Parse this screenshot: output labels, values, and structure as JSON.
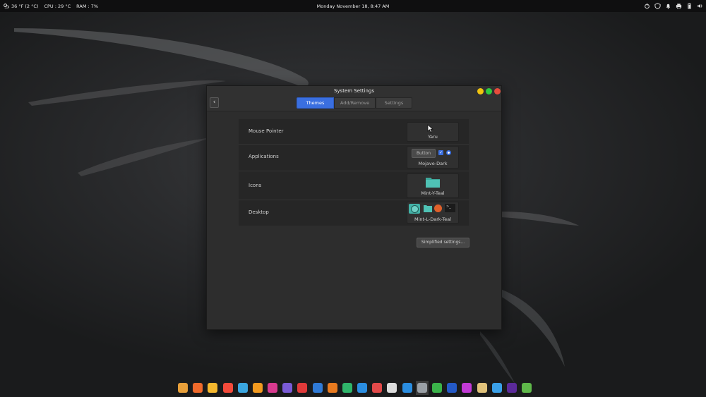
{
  "top_panel": {
    "weather": "36 °F (2 °C)",
    "cpu": "CPU : 29 °C",
    "ram": "RAM : 7%",
    "clock": "Monday November 18, 8:47 AM",
    "tray_icons": [
      "power-icon",
      "shield-icon",
      "bell-icon",
      "printer-icon",
      "battery-icon",
      "volume-icon"
    ]
  },
  "window": {
    "title": "System Settings",
    "tabs": [
      {
        "label": "Themes",
        "active": true
      },
      {
        "label": "Add/Remove",
        "active": false
      },
      {
        "label": "Settings",
        "active": false
      }
    ],
    "rows": [
      {
        "label": "Mouse Pointer",
        "value": "Yaru"
      },
      {
        "label": "Applications",
        "value": "Mojave-Dark",
        "preview_button": "Button"
      },
      {
        "label": "Icons",
        "value": "Mint-Y-Teal"
      },
      {
        "label": "Desktop",
        "value": "Mint-L-Dark-Teal"
      }
    ],
    "simplified_button": "Simplified settings..."
  },
  "dock": {
    "apps": [
      {
        "name": "app-1",
        "color": "#e8a03a"
      },
      {
        "name": "app-2",
        "color": "#f06a2b"
      },
      {
        "name": "app-3",
        "color": "#f5b82e"
      },
      {
        "name": "app-4",
        "color": "#f34a3a"
      },
      {
        "name": "app-5",
        "color": "#3aa6e0"
      },
      {
        "name": "app-6",
        "color": "#f29a1f"
      },
      {
        "name": "app-7",
        "color": "#d83a8f"
      },
      {
        "name": "app-8",
        "color": "#7a5bd6"
      },
      {
        "name": "app-9",
        "color": "#e03a3a"
      },
      {
        "name": "app-10",
        "color": "#2f7ad6"
      },
      {
        "name": "app-11",
        "color": "#e87a1f"
      },
      {
        "name": "app-12",
        "color": "#2fb56a"
      },
      {
        "name": "app-13",
        "color": "#2a8de0"
      },
      {
        "name": "app-14",
        "color": "#e24a4a"
      },
      {
        "name": "app-15",
        "color": "#dcdcdc"
      },
      {
        "name": "app-16",
        "color": "#2a8de0"
      },
      {
        "name": "app-17",
        "color": "#9aa0a6"
      },
      {
        "name": "app-18",
        "color": "#3bb34a"
      },
      {
        "name": "app-19",
        "color": "#2459c6"
      },
      {
        "name": "app-20",
        "color": "#c23ad6"
      },
      {
        "name": "app-21",
        "color": "#e0c27a"
      },
      {
        "name": "app-22",
        "color": "#3aa0e8"
      },
      {
        "name": "app-23",
        "color": "#5b2a9a"
      },
      {
        "name": "app-24",
        "color": "#5fb84a"
      }
    ]
  },
  "colors": {
    "accent": "#3a6fe0",
    "teal": "#42b3a8"
  }
}
